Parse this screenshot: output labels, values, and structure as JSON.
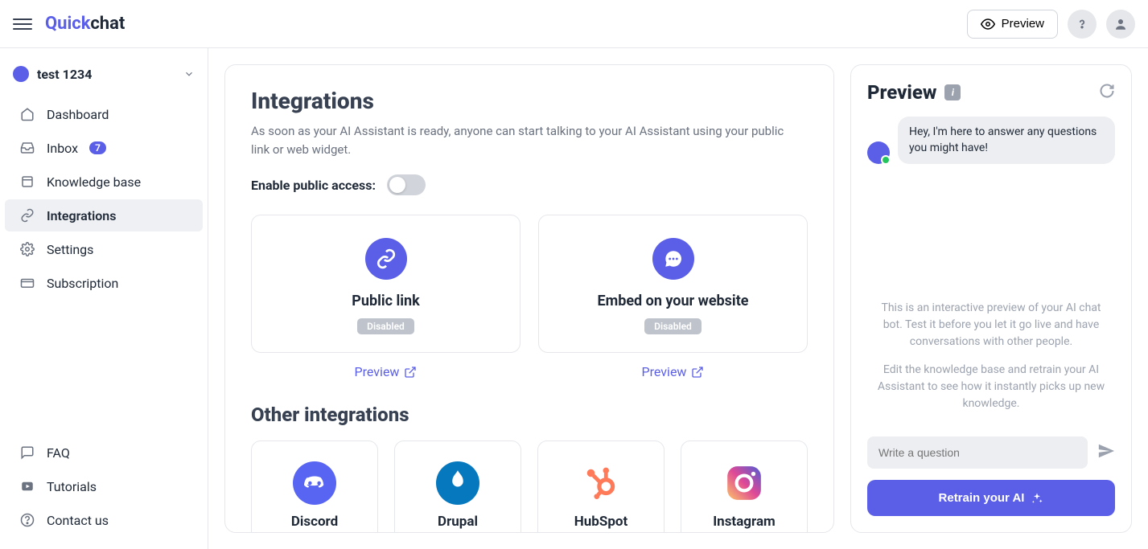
{
  "brand": {
    "q": "Quick",
    "c": "chat"
  },
  "topbar": {
    "preview": "Preview"
  },
  "org": {
    "name": "test 1234"
  },
  "nav": {
    "items": [
      {
        "label": "Dashboard",
        "icon": "home-icon"
      },
      {
        "label": "Inbox",
        "icon": "tray-icon",
        "badge": "7"
      },
      {
        "label": "Knowledge base",
        "icon": "book-icon"
      },
      {
        "label": "Integrations",
        "icon": "link-icon",
        "active": true
      },
      {
        "label": "Settings",
        "icon": "gear-icon"
      },
      {
        "label": "Subscription",
        "icon": "card-icon"
      }
    ],
    "bottom": [
      {
        "label": "FAQ",
        "icon": "chat-icon"
      },
      {
        "label": "Tutorials",
        "icon": "video-icon"
      },
      {
        "label": "Contact us",
        "icon": "help-icon"
      }
    ]
  },
  "content": {
    "title": "Integrations",
    "subtitle": "As soon as your AI Assistant is ready, anyone can start talking to your AI Assistant using your public link or web widget.",
    "toggle_label": "Enable public access:",
    "cards": [
      {
        "title": "Public link",
        "status": "Disabled",
        "preview": "Preview"
      },
      {
        "title": "Embed on your website",
        "status": "Disabled",
        "preview": "Preview"
      }
    ],
    "other_title": "Other integrations",
    "other": [
      {
        "title": "Discord"
      },
      {
        "title": "Drupal"
      },
      {
        "title": "HubSpot"
      },
      {
        "title": "Instagram"
      }
    ]
  },
  "preview": {
    "title": "Preview",
    "greeting": "Hey, I'm here to answer any questions you might have!",
    "hint1": "This is an interactive preview of your AI chat bot. Test it before you let it go live and have conversations with other people.",
    "hint2": "Edit the knowledge base and retrain your AI Assistant to see how it instantly picks up new knowledge.",
    "placeholder": "Write a question",
    "retrain": "Retrain your AI"
  }
}
